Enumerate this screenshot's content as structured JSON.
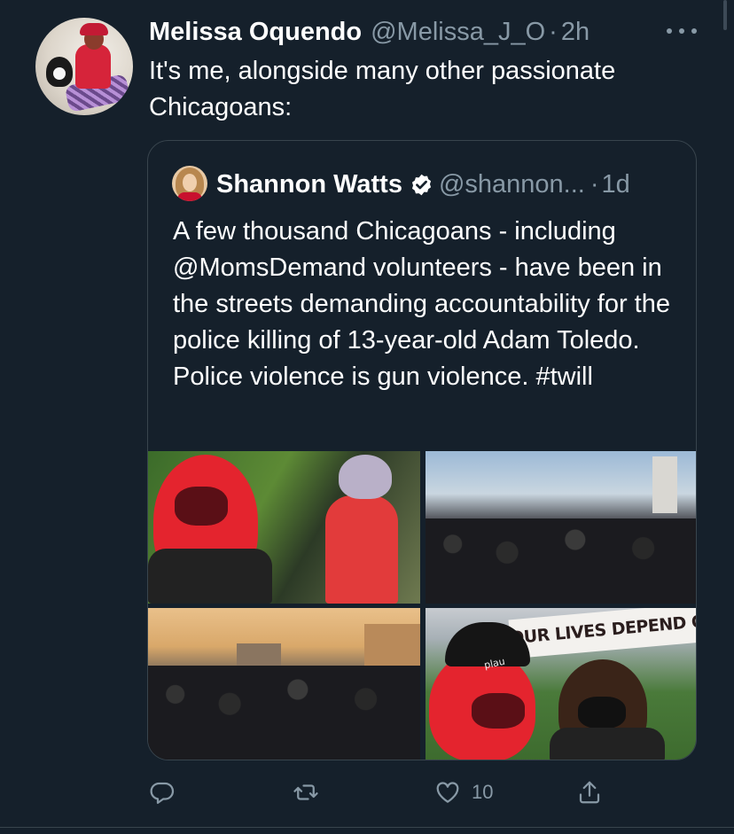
{
  "tweet": {
    "author_name": "Melissa Oquendo",
    "author_handle": "@Melissa_J_O",
    "separator": "·",
    "time": "2h",
    "text": "It's me, alongside many other passionate Chicagoans:"
  },
  "quoted": {
    "author_name": "Shannon Watts",
    "author_handle": "@shannon...",
    "separator": "·",
    "time": "1d",
    "verified": true,
    "text": "A few thousand Chicagoans - including @MomsDemand volunteers - have been in the streets demanding accountability for the police killing of 13-year-old Adam Toledo. Police violence is gun violence. #twill",
    "images": [
      {
        "description_icon": "photo"
      },
      {
        "description_icon": "photo"
      },
      {
        "description_icon": "photo"
      },
      {
        "description_icon": "photo",
        "sign_text": "OUR LIVES DEPEND ON IT!!",
        "beanie_text": "plau"
      }
    ]
  },
  "actions": {
    "reply_icon": "reply-icon",
    "retweet_icon": "retweet-icon",
    "like_icon": "heart-icon",
    "like_count": "10",
    "share_icon": "share-icon"
  },
  "colors": {
    "background": "#15202b",
    "secondary_text": "#8899a6",
    "border": "#38444d",
    "verified": "#ffffff"
  }
}
